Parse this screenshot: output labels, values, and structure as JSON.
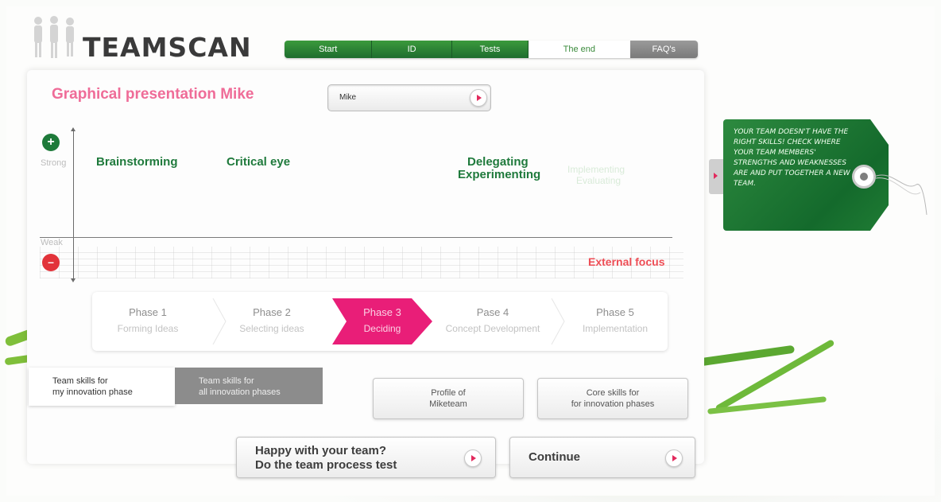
{
  "app": {
    "logo_text": "TEAMSCAN"
  },
  "nav": {
    "items": [
      "Start",
      "ID",
      "Tests",
      "The end",
      "FAQ's"
    ]
  },
  "page": {
    "title": "Graphical presentation Mike"
  },
  "member_select": {
    "value": "Mike"
  },
  "chart": {
    "strong_label": "Strong",
    "weak_label": "Weak",
    "skills": [
      "Brainstorming",
      "Critical eye",
      "Delegating",
      "Experimenting"
    ],
    "ghost_skills": [
      "Implementing",
      "Evaluating"
    ],
    "external_focus": "External focus"
  },
  "phases": [
    {
      "title": "Phase 1",
      "subtitle": "Forming Ideas"
    },
    {
      "title": "Phase 2",
      "subtitle": "Selecting ideas"
    },
    {
      "title": "Phase 3",
      "subtitle": "Deciding"
    },
    {
      "title": "Pase 4",
      "subtitle": "Concept Development"
    },
    {
      "title": "Phase 5",
      "subtitle": "Implementation"
    }
  ],
  "tabs": {
    "my_phase": "Team skills for\nmy innovation phase",
    "all_phases": "Team skills for\nall innovation phases"
  },
  "buttons": {
    "profile": "Profile of\nMiketeam",
    "core_skills": "Core skills for\nfor innovation phases",
    "process_test": "Happy with your team?\nDo the team process test",
    "continue": "Continue"
  },
  "tag": {
    "text": "Your team doesn't have the right skills! Check where your team members' strengths and weaknesses are and put together a new team."
  },
  "colors": {
    "green": "#1f7a3c",
    "pink": "#e91e78",
    "red": "#e2333a"
  }
}
